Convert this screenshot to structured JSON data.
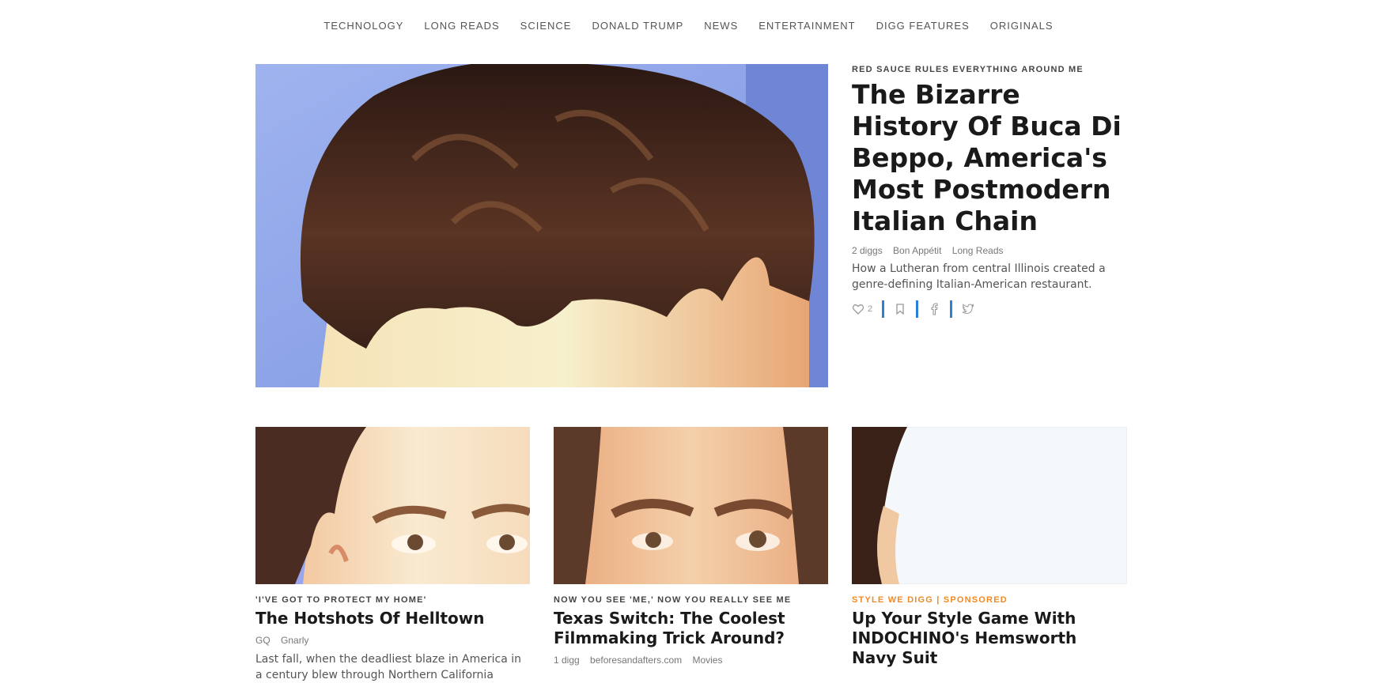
{
  "nav": {
    "items": [
      "TECHNOLOGY",
      "LONG READS",
      "SCIENCE",
      "DONALD TRUMP",
      "NEWS",
      "ENTERTAINMENT",
      "DIGG FEATURES",
      "ORIGINALS"
    ]
  },
  "featured": {
    "kicker": "RED SAUCE RULES EVERYTHING AROUND ME",
    "title": "The Bizarre History Of Buca Di Beppo, America's Most Postmodern Italian Chain",
    "diggs": "2 diggs",
    "source": "Bon Appétit",
    "category": "Long Reads",
    "description": "How a Lutheran from central Illinois created a genre-defining Italian-American restaurant.",
    "digg_count": "2",
    "icons": [
      "heart-icon",
      "bookmark-icon",
      "facebook-icon",
      "twitter-icon"
    ]
  },
  "cards": [
    {
      "kicker": "'I'VE GOT TO PROTECT MY HOME'",
      "title": "The Hotshots Of Helltown",
      "meta": [
        "GQ",
        "Gnarly"
      ],
      "description": "Last fall, when the deadliest blaze in America in a century blew through Northern California"
    },
    {
      "kicker": "NOW YOU SEE 'ME,' NOW YOU REALLY SEE ME",
      "title": "Texas Switch: The Coolest Filmmaking Trick Around?",
      "meta": [
        "1 digg",
        "beforesandafters.com",
        "Movies"
      ]
    },
    {
      "kicker": "STYLE WE DIGG | SPONSORED",
      "title": "Up Your Style Game With INDOCHINO's Hemsworth Navy Suit"
    }
  ],
  "colors": {
    "accent_blue": "#2e7fd9",
    "sponsored_orange": "#f08a24",
    "sky_blue": "#8fa6e8",
    "hair_brown": "#3a2219",
    "skin": "#f2c9a0"
  }
}
